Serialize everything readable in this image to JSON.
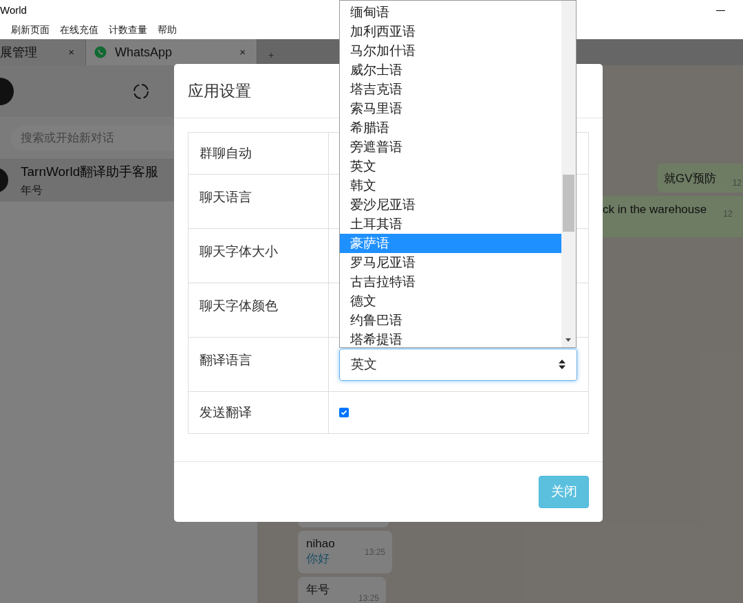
{
  "window": {
    "title": "World"
  },
  "menu": [
    "刷新页面",
    "在线充值",
    "计数查量",
    "帮助"
  ],
  "tabs": [
    {
      "label": "展管理",
      "close": "×",
      "selected": false
    },
    {
      "label": "WhatsApp",
      "close": "×",
      "selected": true
    }
  ],
  "new_tab": "+",
  "sidebar": {
    "search": {
      "placeholder": "搜索或开始新对话"
    },
    "chats": [
      {
        "name": "TarnWorld翻译助手客服",
        "preview": "年号",
        "selected": true
      }
    ]
  },
  "messages_top": [
    {
      "text": "就GV预防",
      "time": "12"
    },
    {
      "text": "ck in the warehouse",
      "time": "12"
    }
  ],
  "messages_bottom": [
    {
      "kind": "covered"
    },
    {
      "kind": "shown",
      "text": "nihao",
      "translation": "你好",
      "time": "13:25"
    },
    {
      "kind": "shown",
      "text": "年号",
      "time": "13:25"
    }
  ],
  "modal": {
    "title": "应用设置",
    "rows": [
      {
        "label": "群聊自动",
        "kind": "hidden"
      },
      {
        "label": "聊天语言",
        "kind": "hidden"
      },
      {
        "label": "聊天字体大小",
        "kind": "hidden"
      },
      {
        "label": "聊天字体颜色",
        "kind": "hidden"
      },
      {
        "label": "翻译语言",
        "kind": "select",
        "value": "英文"
      },
      {
        "label": "发送翻译",
        "kind": "checkbox",
        "checked": true
      }
    ],
    "close_button": "关闭"
  },
  "dropdown": [
    {
      "label": "缅甸语",
      "selected": false
    },
    {
      "label": "加利西亚语",
      "selected": false
    },
    {
      "label": "马尔加什语",
      "selected": false
    },
    {
      "label": "威尔士语",
      "selected": false
    },
    {
      "label": "塔吉克语",
      "selected": false
    },
    {
      "label": "索马里语",
      "selected": false
    },
    {
      "label": "希腊语",
      "selected": false
    },
    {
      "label": "旁遮普语",
      "selected": false
    },
    {
      "label": "英文",
      "selected": false
    },
    {
      "label": "韩文",
      "selected": false
    },
    {
      "label": "爱沙尼亚语",
      "selected": false
    },
    {
      "label": "土耳其语",
      "selected": false
    },
    {
      "label": "豪萨语",
      "selected": true
    },
    {
      "label": "罗马尼亚语",
      "selected": false
    },
    {
      "label": "古吉拉特语",
      "selected": false
    },
    {
      "label": "德文",
      "selected": false
    },
    {
      "label": "约鲁巴语",
      "selected": false
    },
    {
      "label": "塔希提语",
      "selected": false
    }
  ]
}
